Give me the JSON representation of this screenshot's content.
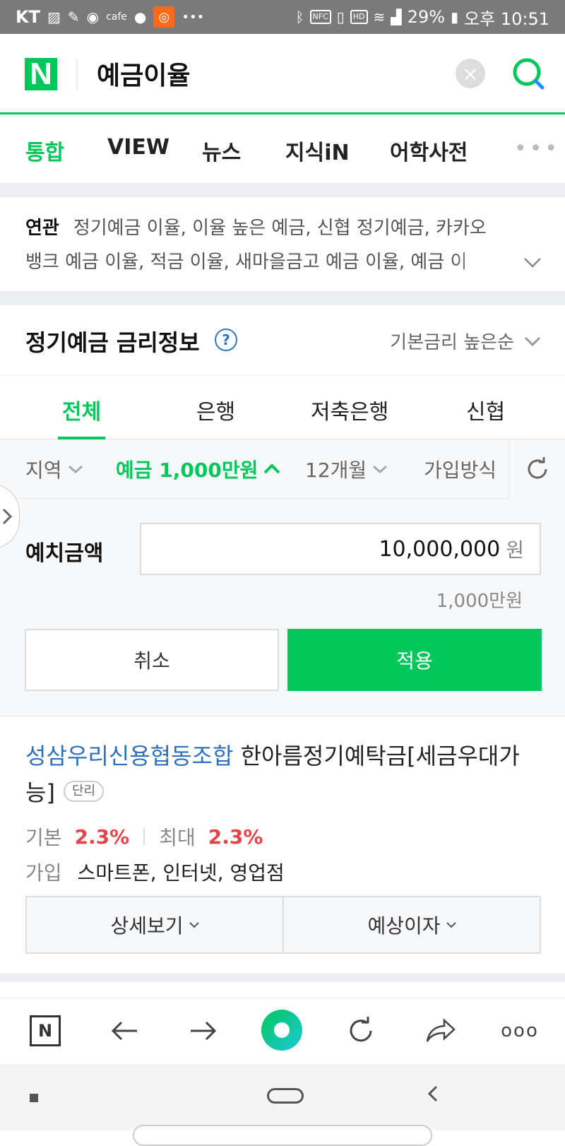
{
  "status_bar": {
    "carrier": "KT",
    "app_label": "cafe",
    "battery": "29%",
    "time": "오후 10:51",
    "more": "•••",
    "nfc": "NFC",
    "hd": "HD"
  },
  "search": {
    "logo": "N",
    "query": "예금이율",
    "clear_glyph": "×"
  },
  "tabs": [
    "통합",
    "VIEW",
    "뉴스",
    "지식iN",
    "어학사전"
  ],
  "tabs_more": "•••",
  "related": {
    "label": "연관",
    "line1": "정기예금 이율, 이율 높은 예금, 신협 정기예금, 카카오",
    "line2": "뱅크 예금 이율, 적금 이율, 새마을금고 예금 이율, 예금 이"
  },
  "rate_info": {
    "title": "정기예금 금리정보",
    "help": "?",
    "sort": "기본금리 높은순"
  },
  "categories": [
    "전체",
    "은행",
    "저축은행",
    "신협"
  ],
  "filters": {
    "region": "지역",
    "amount": "예금 1,000만원",
    "period": "12개월",
    "join_method": "가입방식"
  },
  "deposit": {
    "label": "예치금액",
    "value": "10,000,000",
    "unit": "원",
    "sub": "1,000만원",
    "cancel": "취소",
    "apply": "적용"
  },
  "item": {
    "bank": "성삼우리신용협동조합",
    "product": "한아름정기예탁금[세금우대가능]",
    "badge": "단리",
    "basic_label": "기본",
    "basic_rate": "2.3%",
    "max_label": "최대",
    "max_rate": "2.3%",
    "join_label": "가입",
    "join_value": "스마트폰, 인터넷, 영업점",
    "detail_btn": "상세보기",
    "interest_btn": "예상이자"
  },
  "bottom_nav": {
    "home_logo": "N",
    "more": "ooo"
  },
  "colors": {
    "brand_green": "#03c75a",
    "rate_red": "#e5444b",
    "bank_blue": "#2f6fbc"
  }
}
